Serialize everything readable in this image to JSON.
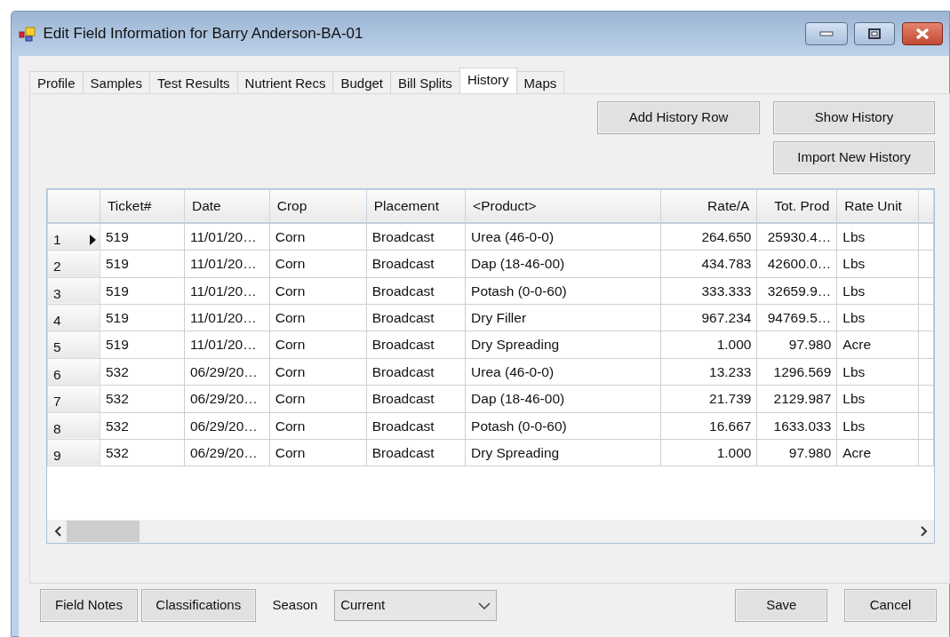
{
  "window": {
    "title": "Edit Field Information for Barry Anderson-BA-01"
  },
  "tabs": [
    {
      "label": "Profile",
      "selected": false
    },
    {
      "label": "Samples",
      "selected": false
    },
    {
      "label": "Test Results",
      "selected": false
    },
    {
      "label": "Nutrient Recs",
      "selected": false
    },
    {
      "label": "Budget",
      "selected": false
    },
    {
      "label": "Bill Splits",
      "selected": false
    },
    {
      "label": "History",
      "selected": true
    },
    {
      "label": "Maps",
      "selected": false
    }
  ],
  "actions": [
    "Add History Row",
    "Show History",
    "Import New History"
  ],
  "table": {
    "columns": [
      {
        "label": "Ticket#",
        "kind": "text"
      },
      {
        "label": "Date",
        "kind": "text"
      },
      {
        "label": "Crop",
        "kind": "text"
      },
      {
        "label": "Placement",
        "kind": "text"
      },
      {
        "label": "<Product>",
        "kind": "text"
      },
      {
        "label": "Rate/A",
        "kind": "number"
      },
      {
        "label": "Tot. Prod",
        "kind": "number"
      },
      {
        "label": "Rate Unit",
        "kind": "text"
      }
    ],
    "rows": [
      {
        "number": "1",
        "current": true,
        "cells": [
          "519",
          "11/01/20…",
          "Corn",
          "Broadcast",
          "Urea (46-0-0)",
          "264.650",
          "25930.4…",
          "Lbs"
        ]
      },
      {
        "number": "2",
        "current": false,
        "cells": [
          "519",
          "11/01/20…",
          "Corn",
          "Broadcast",
          "Dap (18-46-00)",
          "434.783",
          "42600.0…",
          "Lbs"
        ]
      },
      {
        "number": "3",
        "current": false,
        "cells": [
          "519",
          "11/01/20…",
          "Corn",
          "Broadcast",
          "Potash (0-0-60)",
          "333.333",
          "32659.9…",
          "Lbs"
        ]
      },
      {
        "number": "4",
        "current": false,
        "cells": [
          "519",
          "11/01/20…",
          "Corn",
          "Broadcast",
          "Dry Filler",
          "967.234",
          "94769.5…",
          "Lbs"
        ]
      },
      {
        "number": "5",
        "current": false,
        "cells": [
          "519",
          "11/01/20…",
          "Corn",
          "Broadcast",
          "Dry Spreading",
          "1.000",
          "97.980",
          "Acre"
        ]
      },
      {
        "number": "6",
        "current": false,
        "cells": [
          "532",
          "06/29/20…",
          "Corn",
          "Broadcast",
          "Urea (46-0-0)",
          "13.233",
          "1296.569",
          "Lbs"
        ]
      },
      {
        "number": "7",
        "current": false,
        "cells": [
          "532",
          "06/29/20…",
          "Corn",
          "Broadcast",
          "Dap (18-46-00)",
          "21.739",
          "2129.987",
          "Lbs"
        ]
      },
      {
        "number": "8",
        "current": false,
        "cells": [
          "532",
          "06/29/20…",
          "Corn",
          "Broadcast",
          "Potash (0-0-60)",
          "16.667",
          "1633.033",
          "Lbs"
        ]
      },
      {
        "number": "9",
        "current": false,
        "cells": [
          "532",
          "06/29/20…",
          "Corn",
          "Broadcast",
          "Dry Spreading",
          "1.000",
          "97.980",
          "Acre"
        ]
      }
    ]
  },
  "footer": {
    "left_buttons": [
      "Field Notes",
      "Classifications"
    ],
    "season_label": "Season",
    "season": {
      "value": "Current"
    },
    "right_buttons": [
      "Save",
      "Cancel"
    ]
  }
}
